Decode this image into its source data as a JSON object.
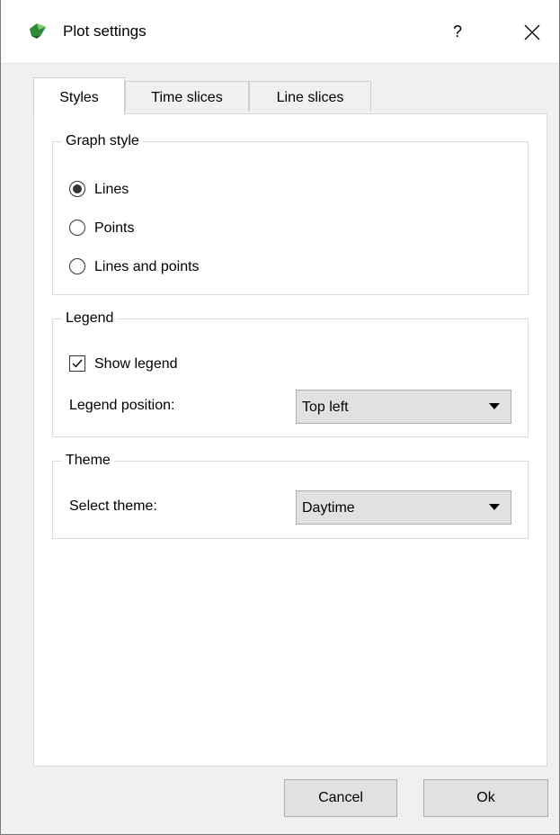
{
  "window": {
    "title": "Plot settings",
    "help_label": "?"
  },
  "tabs": [
    {
      "label": "Styles",
      "active": true
    },
    {
      "label": "Time slices",
      "active": false
    },
    {
      "label": "Line slices",
      "active": false
    }
  ],
  "graph_style": {
    "title": "Graph style",
    "options": [
      {
        "label": "Lines",
        "checked": true
      },
      {
        "label": "Points",
        "checked": false
      },
      {
        "label": "Lines and points",
        "checked": false
      }
    ]
  },
  "legend": {
    "title": "Legend",
    "show_label": "Show legend",
    "show_checked": true,
    "position_label": "Legend position:",
    "position_value": "Top left"
  },
  "theme": {
    "title": "Theme",
    "select_label": "Select theme:",
    "select_value": "Daytime"
  },
  "buttons": {
    "cancel": "Cancel",
    "ok": "Ok"
  },
  "icons": {
    "app": "app-icon",
    "close": "close-icon",
    "help": "help-icon"
  }
}
